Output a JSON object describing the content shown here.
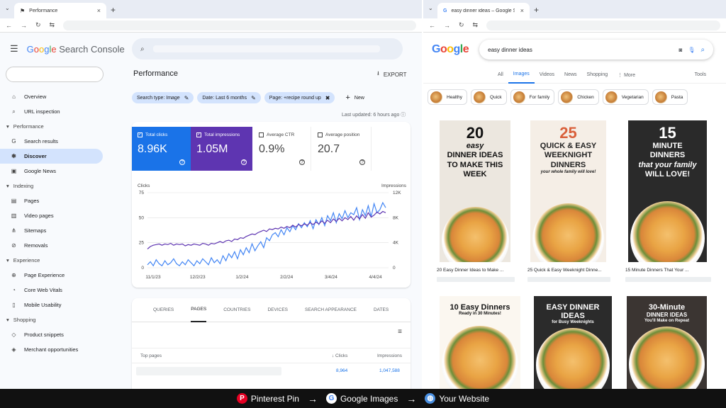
{
  "left_browser": {
    "tab_title": "Performance",
    "tab_close": "×",
    "new_tab": "+"
  },
  "right_browser": {
    "tab_title": "easy dinner ideas – Google Sea",
    "tab_close": "×",
    "new_tab": "+"
  },
  "gsc": {
    "brand_google": "Google",
    "brand_product": " Search Console",
    "page_title": "Performance",
    "export_label": "EXPORT",
    "filters": [
      "Search type: Image",
      "Date: Last 6 months",
      "Page: +recipe round up"
    ],
    "new_label": "New",
    "last_updated": "Last updated: 6 hours ago",
    "sidebar": {
      "top_items": [
        {
          "label": "Overview",
          "icon": "home-icon"
        },
        {
          "label": "URL inspection",
          "icon": "search-icon"
        }
      ],
      "sections": [
        {
          "title": "Performance",
          "items": [
            {
              "label": "Search results",
              "icon": "google-g-icon",
              "active": false
            },
            {
              "label": "Discover",
              "icon": "discover-icon",
              "active": true
            },
            {
              "label": "Google News",
              "icon": "news-icon",
              "active": false
            }
          ]
        },
        {
          "title": "Indexing",
          "items": [
            {
              "label": "Pages",
              "icon": "pages-icon",
              "active": false
            },
            {
              "label": "Video pages",
              "icon": "video-pages-icon",
              "active": false
            },
            {
              "label": "Sitemaps",
              "icon": "sitemaps-icon",
              "active": false
            },
            {
              "label": "Removals",
              "icon": "removals-icon",
              "active": false
            }
          ]
        },
        {
          "title": "Experience",
          "items": [
            {
              "label": "Page Experience",
              "icon": "page-experience-icon",
              "active": false
            },
            {
              "label": "Core Web Vitals",
              "icon": "vitals-icon",
              "active": false
            },
            {
              "label": "Mobile Usability",
              "icon": "mobile-icon",
              "active": false
            }
          ]
        },
        {
          "title": "Shopping",
          "items": [
            {
              "label": "Product snippets",
              "icon": "product-icon",
              "active": false
            },
            {
              "label": "Merchant opportunities",
              "icon": "merchant-icon",
              "active": false
            }
          ]
        }
      ]
    },
    "metrics": [
      {
        "label": "Total clicks",
        "value": "8.96K",
        "checked": true
      },
      {
        "label": "Total impressions",
        "value": "1.05M",
        "checked": true
      },
      {
        "label": "Average CTR",
        "value": "0.9%",
        "checked": false
      },
      {
        "label": "Average position",
        "value": "20.7",
        "checked": false
      }
    ],
    "table_tabs": [
      "QUERIES",
      "PAGES",
      "COUNTRIES",
      "DEVICES",
      "SEARCH APPEARANCE",
      "DATES"
    ],
    "active_table_tab": "PAGES",
    "table": {
      "col_pages": "Top pages",
      "col_clicks": "↓ Clicks",
      "col_impressions": "Impressions",
      "rows": [
        {
          "clicks": "8,964",
          "impressions": "1,047,588"
        }
      ]
    }
  },
  "chart_data": {
    "type": "line",
    "ylabel": "Clicks",
    "y2label": "Impressions",
    "x_ticks": [
      "11/1/23",
      "12/2/23",
      "1/2/24",
      "2/2/24",
      "3/4/24",
      "4/4/24"
    ],
    "y_ticks": [
      "0",
      "25",
      "50",
      "75"
    ],
    "y2_ticks": [
      "0",
      "4K",
      "8K",
      "12K"
    ],
    "ylim": [
      0,
      75
    ],
    "y2lim": [
      0,
      12000
    ],
    "series": [
      {
        "name": "Clicks",
        "color": "#4285f4",
        "values": [
          3,
          6,
          2,
          8,
          4,
          2,
          7,
          3,
          5,
          9,
          4,
          2,
          6,
          3,
          8,
          5,
          2,
          7,
          4,
          9,
          6,
          3,
          10,
          5,
          8,
          4,
          12,
          7,
          14,
          10,
          16,
          9,
          18,
          13,
          20,
          15,
          24,
          17,
          22,
          26,
          20,
          30,
          27,
          33,
          35,
          31,
          38,
          33,
          40,
          36,
          42,
          38,
          44,
          40,
          45,
          41,
          47,
          39,
          48,
          43,
          50,
          42,
          52,
          47,
          55,
          45,
          54,
          49,
          57,
          50,
          55,
          53,
          60,
          48,
          58,
          52,
          62,
          51,
          64,
          55,
          58,
          65,
          60
        ]
      },
      {
        "name": "Impressions",
        "color": "#5e35b1",
        "values": [
          3000,
          3400,
          3600,
          3700,
          3800,
          3600,
          3800,
          3700,
          3900,
          3600,
          3800,
          3700,
          3800,
          3500,
          3700,
          3600,
          3800,
          3700,
          3600,
          3900,
          3800,
          3600,
          3900,
          3800,
          4000,
          4200,
          4000,
          4300,
          4400,
          4200,
          4600,
          4500,
          4800,
          4700,
          5000,
          5200,
          5400,
          5300,
          5600,
          5800,
          6000,
          5800,
          6200,
          6100,
          6300,
          6200,
          6500,
          6300,
          6600,
          6400,
          6800,
          6500,
          6900,
          6700,
          7000,
          6800,
          7200,
          6900,
          7300,
          7000,
          7500,
          7100,
          7600,
          7200,
          7800,
          7400,
          7900,
          7500,
          8000,
          7700,
          8200,
          7600,
          8300,
          7800,
          8500,
          7900,
          8800,
          8100,
          8400,
          8900,
          8600,
          9000,
          8800
        ]
      }
    ]
  },
  "google": {
    "logo": "Google",
    "query": "easy dinner ideas",
    "tabs": [
      "All",
      "Images",
      "Videos",
      "News",
      "Shopping",
      "⋮ More"
    ],
    "active_tab": "Images",
    "tools_label": "Tools",
    "chips": [
      "Healthy",
      "Quick",
      "For family",
      "Chicken",
      "Vegetarian",
      "Pasta"
    ],
    "results": [
      {
        "big": "20",
        "lines": [
          "easy",
          "DINNER IDEAS",
          "TO MAKE THIS WEEK"
        ],
        "title": "20 Easy Dinner Ideas to Make ..."
      },
      {
        "big": "25",
        "lines": [
          "QUICK & EASY",
          "WEEKNIGHT",
          "DINNERS",
          "your whole family will love!"
        ],
        "title": "25 Quick & Easy Weeknight Dinne..."
      },
      {
        "big": "15",
        "lines": [
          "MINUTE",
          "DINNERS",
          "that your family",
          "WILL LOVE!"
        ],
        "title": "15 Minute Dinners That Your ..."
      },
      {
        "big": "10 Easy Dinners",
        "lines": [
          "Ready in 30 Minutes!"
        ],
        "title": ""
      },
      {
        "big": "EASY DINNER IDEAS",
        "lines": [
          "for Busy Weeknights"
        ],
        "title": ""
      },
      {
        "big": "30-Minute",
        "lines": [
          "DINNER IDEAS",
          "You'll Make on Repeat"
        ],
        "title": ""
      }
    ]
  },
  "footer": {
    "steps": [
      "Pinterest Pin",
      "Google Images",
      "Your Website"
    ],
    "arrow": "→"
  },
  "colors": {
    "accent_blue": "#1a73e8",
    "impressions_purple": "#5e35b1",
    "nav_active": "#d3e3fd"
  }
}
